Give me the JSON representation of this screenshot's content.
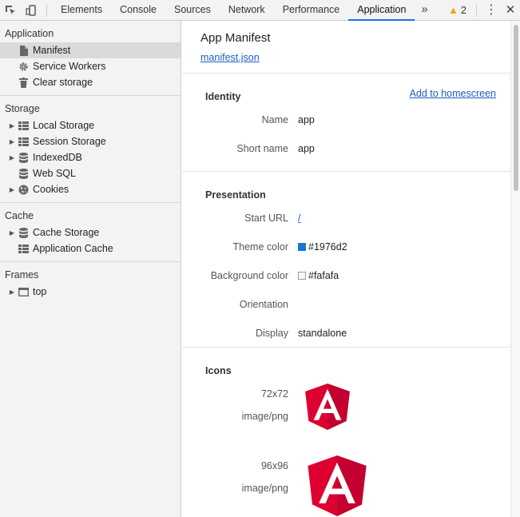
{
  "toolbar": {
    "tabs": [
      "Elements",
      "Console",
      "Sources",
      "Network",
      "Performance",
      "Application"
    ],
    "active_tab": "Application",
    "more": "»",
    "warning_count": "2",
    "accent": "#1a73e8"
  },
  "sidebar": {
    "application": {
      "title": "Application",
      "items": [
        "Manifest",
        "Service Workers",
        "Clear storage"
      ]
    },
    "storage": {
      "title": "Storage",
      "items": [
        "Local Storage",
        "Session Storage",
        "IndexedDB",
        "Web SQL",
        "Cookies"
      ]
    },
    "cache": {
      "title": "Cache",
      "items": [
        "Cache Storage",
        "Application Cache"
      ]
    },
    "frames": {
      "title": "Frames",
      "items": [
        "top"
      ]
    }
  },
  "main": {
    "title": "App Manifest",
    "manifest_link": "manifest.json",
    "identity": {
      "title": "Identity",
      "add_link": "Add to homescreen",
      "name_key": "Name",
      "name_val": "app",
      "short_key": "Short name",
      "short_val": "app"
    },
    "presentation": {
      "title": "Presentation",
      "start_key": "Start URL",
      "start_val": "/",
      "theme_key": "Theme color",
      "theme_val": "#1976d2",
      "bg_key": "Background color",
      "bg_val": "#fafafa",
      "orient_key": "Orientation",
      "orient_val": "",
      "display_key": "Display",
      "display_val": "standalone"
    },
    "icons": {
      "title": "Icons",
      "list": [
        {
          "size": "72x72",
          "type": "image/png"
        },
        {
          "size": "96x96",
          "type": "image/png"
        }
      ]
    }
  }
}
